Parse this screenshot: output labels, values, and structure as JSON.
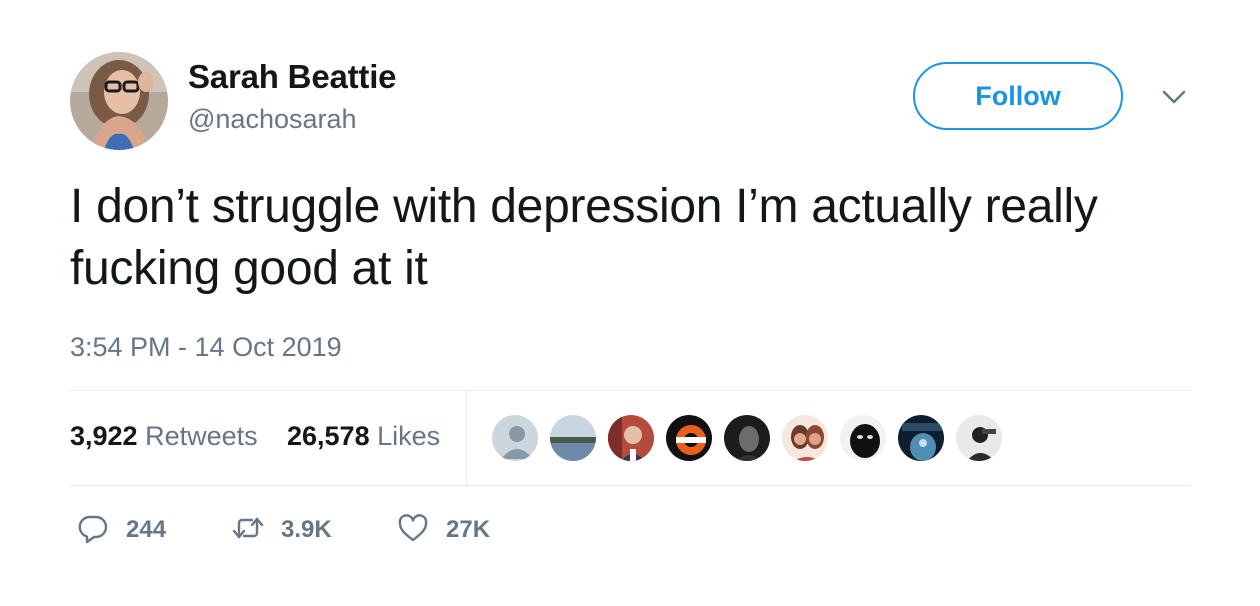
{
  "user": {
    "name": "Sarah Beattie",
    "handle": "@nachosarah"
  },
  "follow_button_label": "Follow",
  "tweet": {
    "text": "I don’t struggle with depression I’m actually really fucking good at it",
    "timestamp": "3:54 PM - 14 Oct 2019"
  },
  "stats": {
    "retweets_count": "3,922",
    "retweets_label": "Retweets",
    "likes_count": "26,578",
    "likes_label": "Likes"
  },
  "actions": {
    "replies": "244",
    "retweets": "3.9K",
    "likes": "27K"
  },
  "icons": [
    "user-avatar",
    "chevron-down-icon",
    "reply-icon",
    "retweet-icon",
    "heart-icon"
  ],
  "colors": {
    "accent": "#1b95e0",
    "secondary_text": "#657786",
    "primary_text": "#14171a",
    "divider": "#e6ecf0"
  }
}
